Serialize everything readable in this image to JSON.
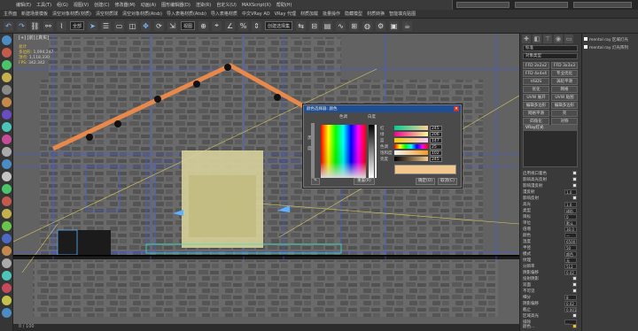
{
  "menubar": {
    "items": [
      "编辑(E)",
      "工具(T)",
      "组(G)",
      "视图(V)",
      "创建(C)",
      "修改器(M)",
      "动画(A)",
      "图形编辑器(D)",
      "渲染(R)",
      "自定义(U)",
      "MAXScript(X)",
      "帮助(H)"
    ]
  },
  "tabbar": {
    "items": [
      "主界面",
      "新建场景模板",
      "清空对象材质(材质)",
      "清空材质球",
      "清空对象材质(Atsb)",
      "导入表格材质(Atsb)",
      "导入表格材质",
      "中文VRay AO",
      "VRay 代理",
      "材质加载",
      "批量操作",
      "隐藏模型",
      "材质转换",
      "智能填充贴图"
    ]
  },
  "toolbar": {
    "select_filter": "全部",
    "view_dropdown": "视图",
    "create_set": "创建选择集"
  },
  "viewport": {
    "label": "[+] [前] [真实]",
    "stats": {
      "total_label": "总计",
      "poly_label": "多边形:",
      "poly_value": "1,094,247",
      "vert_label": "顶点:",
      "vert_value": "1,118,330",
      "fps_label": "FPS:",
      "fps_value": "342.342"
    }
  },
  "color_picker": {
    "title": "颜色选择器: 颜色",
    "hue_header": "色调",
    "white_header": "白度",
    "black_label": "黑",
    "degree_label": "度",
    "sliders": [
      {
        "label": "红",
        "value": "245"
      },
      {
        "label": "绿",
        "value": "206"
      },
      {
        "label": "蓝",
        "value": "147"
      },
      {
        "label": "色调",
        "value": "25"
      },
      {
        "label": "饱和度",
        "value": "102"
      },
      {
        "label": "亮度",
        "value": "245"
      }
    ],
    "reset_label": "重置(R)",
    "ok_label": "确定(O)",
    "cancel_label": "取消(C)",
    "current_color": "#f4c88c"
  },
  "command_panel": {
    "category_dropdown": "标准",
    "object_type_dropdown": "对象类型",
    "buttons": [
      "FFD 2x2x2",
      "FFD 3x3x3",
      "FFD 4x4x4",
      "专业优化",
      "HSDS",
      "涡轮平滑",
      "优化",
      "网格",
      "UVW 展开",
      "UVW 贴图",
      "编辑多边形",
      "编辑多边形",
      "网格平滑",
      "壳",
      "四角化",
      "对称"
    ],
    "list_header": "VRay灯光",
    "params": [
      {
        "label": "启用视口着色",
        "type": "chk"
      },
      {
        "label": "影响高光反射",
        "type": "chk"
      },
      {
        "label": "影响漫反射",
        "type": "chk"
      },
      {
        "label": "漫反射",
        "type": "val",
        "value": "1.0"
      },
      {
        "label": "影响反射",
        "type": "chk"
      },
      {
        "label": "高光",
        "type": "val",
        "value": "1.0"
      },
      {
        "label": "类型",
        "type": "val",
        "value": "球形"
      },
      {
        "label": "目标",
        "type": "val",
        "value": "0"
      },
      {
        "label": "单位",
        "type": "val",
        "value": "默认"
      },
      {
        "label": "倍增",
        "type": "val",
        "value": "30.0"
      },
      {
        "label": "颜色",
        "type": "val",
        "value": "—"
      },
      {
        "label": "温度",
        "type": "val",
        "value": "6500"
      },
      {
        "label": "半径",
        "type": "val",
        "value": "50"
      },
      {
        "label": "模式",
        "type": "val",
        "value": "颜色"
      },
      {
        "label": "纹理",
        "type": "val",
        "value": "无"
      },
      {
        "label": "分辨率",
        "type": "val",
        "value": "512"
      },
      {
        "label": "阴影偏移",
        "type": "val",
        "value": "0.02"
      },
      {
        "label": "投射阴影",
        "type": "chk"
      },
      {
        "label": "双面",
        "type": "chk"
      },
      {
        "label": "不可见",
        "type": "chk"
      },
      {
        "label": "细分",
        "type": "val",
        "value": "8"
      },
      {
        "label": "阴影偏移",
        "type": "val",
        "value": "0.02"
      },
      {
        "label": "截止",
        "type": "val",
        "value": "0.001"
      },
      {
        "label": "区域高光",
        "type": "chk"
      },
      {
        "label": "排除",
        "type": "val",
        "value": "..."
      }
    ],
    "footer": "颜色..."
  },
  "side_panel": {
    "rows": [
      "mental ray 区域灯光",
      "mental ray 灯光阵列"
    ]
  },
  "status": {
    "frame": "0 / 100"
  }
}
